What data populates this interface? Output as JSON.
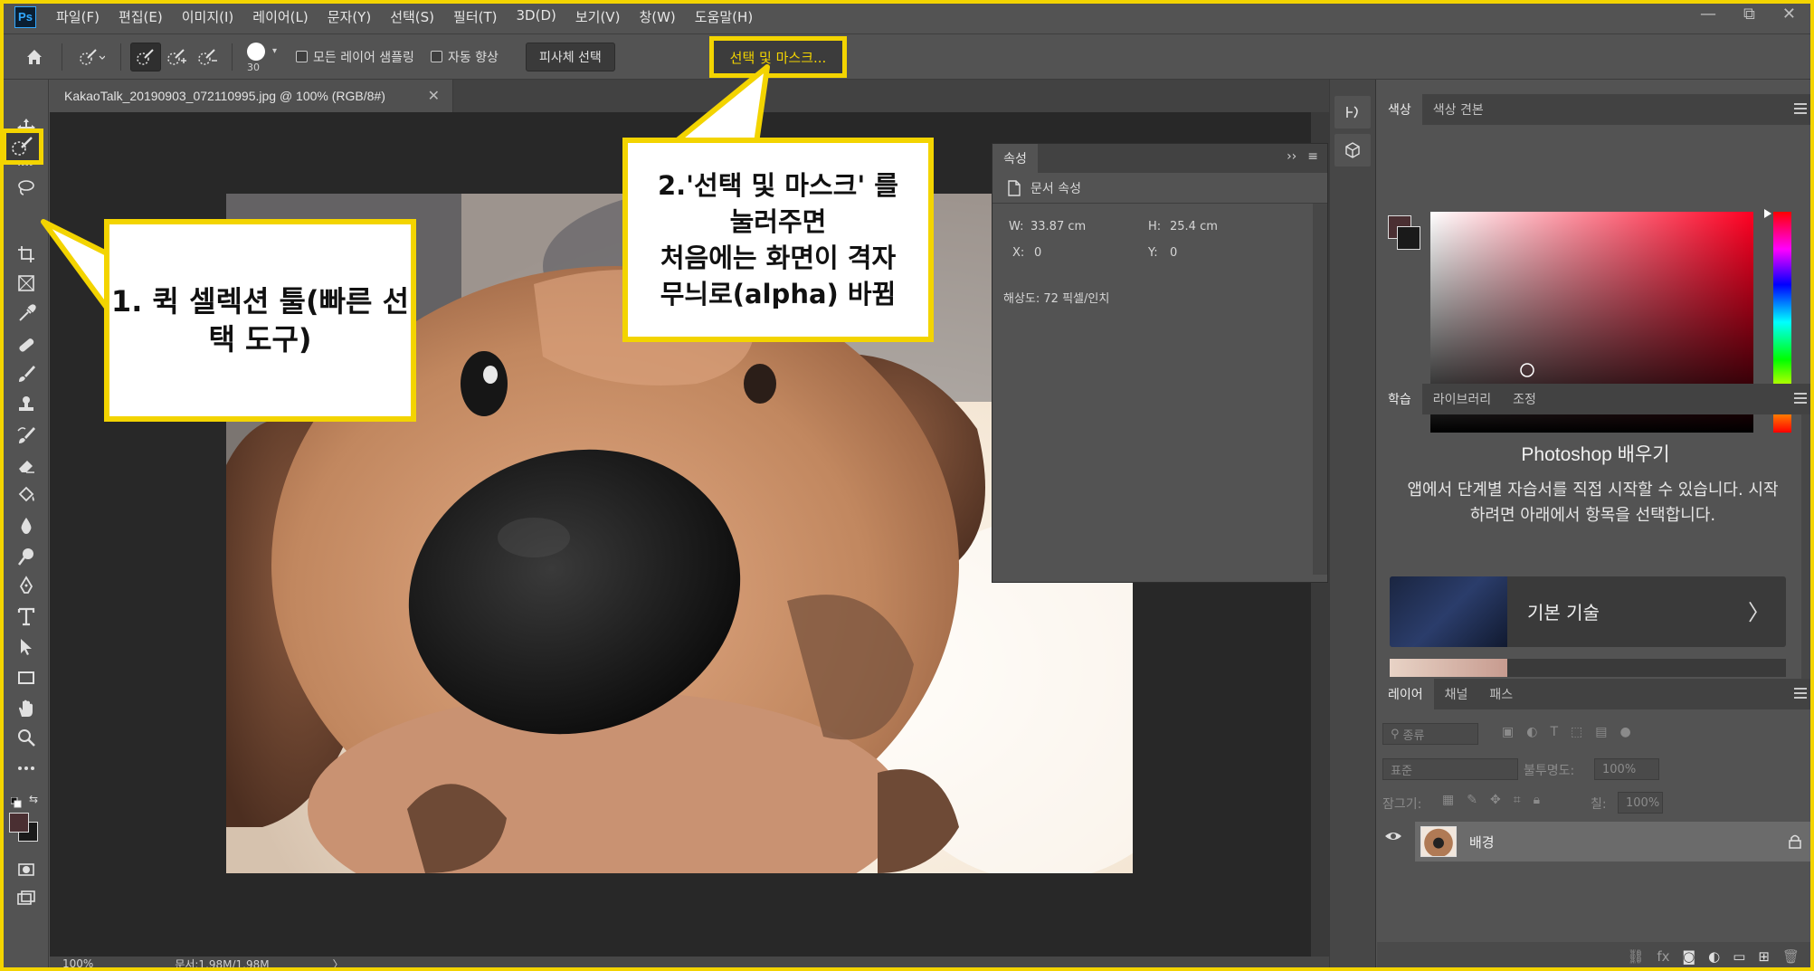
{
  "app": {
    "logo": "Ps",
    "menus": [
      "파일(F)",
      "편집(E)",
      "이미지(I)",
      "레이어(L)",
      "문자(Y)",
      "선택(S)",
      "필터(T)",
      "3D(D)",
      "보기(V)",
      "창(W)",
      "도움말(H)"
    ],
    "window_controls": [
      "—",
      "⧉",
      "✕"
    ]
  },
  "options": {
    "brush_size": "30",
    "sample_all_layers": "모든 레이어 샘플링",
    "auto_enhance": "자동 향상",
    "select_subject": "피사체 선택",
    "select_and_mask": "선택 및 마스크..."
  },
  "document": {
    "tab_title": "KakaoTalk_20190903_072110995.jpg @ 100% (RGB/8#)",
    "close": "✕",
    "zoom": "100%",
    "doc_size": "문서:1.98M/1.98M",
    "status_arrow": "〉"
  },
  "properties": {
    "tab": "속성",
    "expand": "››",
    "subtitle": "문서 속성",
    "w_label": "W:",
    "w_value": "33.87 cm",
    "h_label": "H:",
    "h_value": "25.4 cm",
    "x_label": "X:",
    "x_value": "0",
    "y_label": "Y:",
    "y_value": "0",
    "resolution": "해상도: 72 픽셀/인치"
  },
  "color_panel": {
    "tabs": [
      "색상",
      "색상 견본"
    ],
    "fg_color": "#4a2f32",
    "bg_color": "#1a1a1a"
  },
  "learn_panel": {
    "tabs": [
      "학습",
      "라이브러리",
      "조정"
    ],
    "title": "Photoshop 배우기",
    "description": "앱에서 단계별 자습서를 직접 시작할 수 있습니다. 시작하려면 아래에서 항목을 선택합니다.",
    "card_label": "기본 기술",
    "card_chevron": "〉"
  },
  "layers_panel": {
    "tabs": [
      "레이어",
      "채널",
      "패스"
    ],
    "filter_placeholder": "종류",
    "blend_mode": "표준",
    "opacity_label": "불투명도:",
    "opacity_value": "100%",
    "lock_label": "잠그기:",
    "fill_label": "칠:",
    "fill_value": "100%",
    "layer_name": "배경"
  },
  "annotations": {
    "callout1": "1. 퀵 셀렉션 툴(빠른 선택 도구)",
    "callout2_line1": "2.'선택 및 마스크' 를",
    "callout2_line2": "눌러주면",
    "callout2_line3": "처음에는 화면이 격자",
    "callout2_line4": "무늬로(alpha) 바뀜"
  }
}
